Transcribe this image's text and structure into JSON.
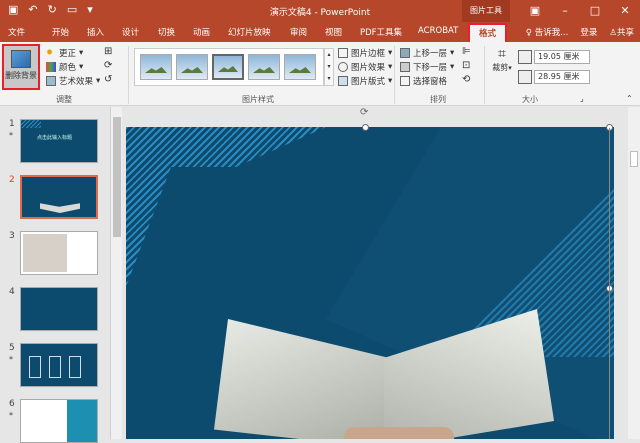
{
  "window": {
    "title": "演示文稿4 - PowerPoint",
    "context_tab_group": "图片工具",
    "qat": [
      "save-icon",
      "undo-icon",
      "redo-icon",
      "slideshow-icon",
      "customize-icon"
    ]
  },
  "tabs": {
    "items": [
      {
        "label": "文件",
        "name": "tab-file"
      },
      {
        "label": "开始",
        "name": "tab-home"
      },
      {
        "label": "插入",
        "name": "tab-insert"
      },
      {
        "label": "设计",
        "name": "tab-design"
      },
      {
        "label": "切换",
        "name": "tab-transitions"
      },
      {
        "label": "动画",
        "name": "tab-animations"
      },
      {
        "label": "幻灯片放映",
        "name": "tab-slideshow"
      },
      {
        "label": "审阅",
        "name": "tab-review"
      },
      {
        "label": "视图",
        "name": "tab-view"
      },
      {
        "label": "PDF工具集",
        "name": "tab-pdf"
      },
      {
        "label": "ACROBAT",
        "name": "tab-acrobat"
      }
    ],
    "active": "格式",
    "tell_me": "告诉我...",
    "login": "登录",
    "share": "共享"
  },
  "ribbon": {
    "adjust": {
      "remove_bg": "删除背景",
      "corrections": "更正",
      "color": "颜色",
      "artistic": "艺术效果",
      "label": "调整"
    },
    "styles": {
      "label": "图片样式",
      "border": "图片边框",
      "effects": "图片效果",
      "layout": "图片版式"
    },
    "arrange": {
      "label": "排列",
      "bring_forward": "上移一层",
      "send_backward": "下移一层",
      "selection_pane": "选择窗格"
    },
    "size": {
      "label": "大小",
      "crop": "裁剪",
      "height": "19.05 厘米",
      "width": "28.95 厘米"
    }
  },
  "slides": [
    {
      "num": "1",
      "star": "*",
      "caption": "点击此输入标题"
    },
    {
      "num": "2",
      "star": "",
      "caption": ""
    },
    {
      "num": "3",
      "star": "",
      "caption": ""
    },
    {
      "num": "4",
      "star": "",
      "caption": ""
    },
    {
      "num": "5",
      "star": "*",
      "caption": ""
    },
    {
      "num": "6",
      "star": "*",
      "caption": ""
    }
  ],
  "colors": {
    "accent": "#b7472a",
    "slide_bg": "#0d4b6e",
    "stripe": "#2b8bc0"
  }
}
